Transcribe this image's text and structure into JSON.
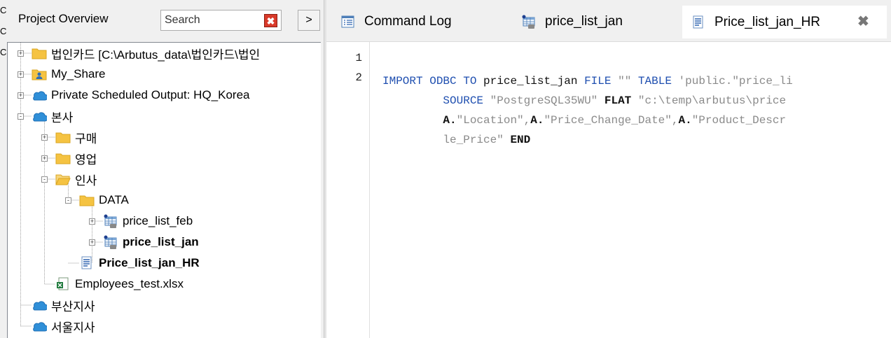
{
  "left_panel": {
    "title": "Project Overview",
    "search": {
      "placeholder": "Search",
      "value": ""
    },
    "edge_fragments": [
      "C",
      "Cl",
      "Ca"
    ],
    "tree": [
      {
        "label": "법인카드 [C:\\Arbutus_data\\법인카드\\법인",
        "icon": "folder-icon",
        "expander": "+",
        "depth": 0,
        "bold": false
      },
      {
        "label": "My_Share",
        "icon": "user-folder-icon",
        "expander": "+",
        "depth": 0,
        "bold": false
      },
      {
        "label": "Private Scheduled Output:  HQ_Korea",
        "icon": "cloud-folder-icon",
        "expander": "+",
        "depth": 0,
        "bold": false
      },
      {
        "label": "본사",
        "icon": "cloud-folder-icon",
        "expander": "-",
        "depth": 0,
        "bold": false
      },
      {
        "label": "구매",
        "icon": "folder-icon",
        "expander": "+",
        "depth": 1,
        "bold": false
      },
      {
        "label": "영업",
        "icon": "folder-icon",
        "expander": "+",
        "depth": 1,
        "bold": false
      },
      {
        "label": "인사",
        "icon": "open-folder-icon",
        "expander": "-",
        "depth": 1,
        "bold": false
      },
      {
        "label": "DATA",
        "icon": "folder-icon",
        "expander": "-",
        "depth": 2,
        "bold": false
      },
      {
        "label": "price_list_feb",
        "icon": "table-icon",
        "expander": "+",
        "depth": 3,
        "bold": false
      },
      {
        "label": "price_list_jan",
        "icon": "table-icon",
        "expander": "+",
        "depth": 3,
        "bold": true
      },
      {
        "label": "Price_list_jan_HR",
        "icon": "script-icon",
        "expander": "",
        "depth": 2,
        "bold": true
      },
      {
        "label": "Employees_test.xlsx",
        "icon": "excel-file-icon",
        "expander": "",
        "depth": 1,
        "bold": false
      },
      {
        "label": "부산지사",
        "icon": "cloud-folder-icon",
        "expander": "",
        "depth": 0,
        "bold": false
      },
      {
        "label": "서울지사",
        "icon": "cloud-folder-icon",
        "expander": "",
        "depth": 0,
        "bold": false
      }
    ]
  },
  "tabs": [
    {
      "label": "Command Log",
      "icon": "log-icon",
      "active": false
    },
    {
      "label": "price_list_jan",
      "icon": "table-icon",
      "active": false
    },
    {
      "label": "Price_list_jan_HR",
      "icon": "script-icon",
      "active": true
    }
  ],
  "editor": {
    "line_numbers": [
      "1",
      "2"
    ],
    "lines": [
      [],
      [
        {
          "t": "IMPORT ",
          "c": "kw"
        },
        {
          "t": "ODBC ",
          "c": "kw"
        },
        {
          "t": "TO ",
          "c": "kw"
        },
        {
          "t": "price_list_jan ",
          "c": "id"
        },
        {
          "t": "FILE ",
          "c": "kw"
        },
        {
          "t": "\"\" ",
          "c": "str"
        },
        {
          "t": "TABLE ",
          "c": "kw"
        },
        {
          "t": "'public.\"price_li",
          "c": "str"
        }
      ],
      [
        {
          "t": "         ",
          "c": "id"
        },
        {
          "t": "SOURCE ",
          "c": "kw"
        },
        {
          "t": "\"PostgreSQL35WU\" ",
          "c": "str"
        },
        {
          "t": "FLAT ",
          "c": "bold-tok"
        },
        {
          "t": "\"c:\\temp\\arbutus\\price",
          "c": "str"
        }
      ],
      [
        {
          "t": "         ",
          "c": "id"
        },
        {
          "t": "A.",
          "c": "bold-tok"
        },
        {
          "t": "\"Location\",",
          "c": "str"
        },
        {
          "t": "A.",
          "c": "bold-tok"
        },
        {
          "t": "\"Price_Change_Date\",",
          "c": "str"
        },
        {
          "t": "A.",
          "c": "bold-tok"
        },
        {
          "t": "\"Product_Descr",
          "c": "str"
        }
      ],
      [
        {
          "t": "         ",
          "c": "id"
        },
        {
          "t": "le_Price\" ",
          "c": "str"
        },
        {
          "t": "END",
          "c": "bold-tok"
        }
      ]
    ]
  },
  "colors": {
    "keyword": "#1f4fb0",
    "string": "#8a8a8a",
    "folder": "#f5c342",
    "cloud": "#2f8fd8",
    "close_red": "#d93a2a"
  }
}
